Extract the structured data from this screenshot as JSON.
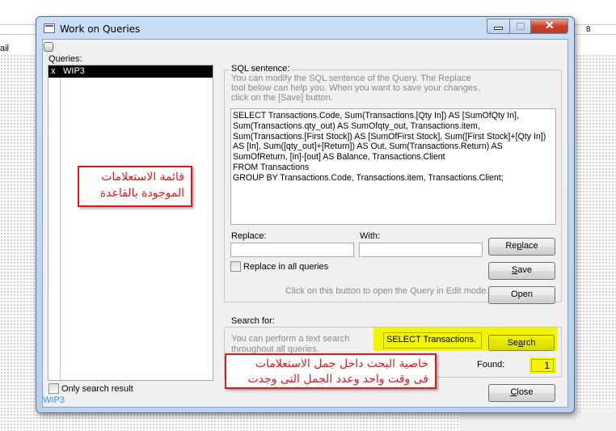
{
  "background": {
    "ruler_mark": "8",
    "section_label": "ail"
  },
  "window": {
    "title": "Work on Queries",
    "icon": "form-icon"
  },
  "queries": {
    "label": "Queries:",
    "items": [
      {
        "marker": "x",
        "name": "WIP3",
        "selected": true
      }
    ],
    "only_search_result_label": "Only search result",
    "only_search_result_checked": false,
    "current_query": "WIP3"
  },
  "sql": {
    "group_label": "SQL sentence:",
    "help_lines": [
      "You can modify the SQL sentence of the Query. The Replace",
      "tool below can help you. When you want to save your changes,",
      "click on the [Save] button."
    ],
    "text": "SELECT Transactions.Code, Sum(Transactions.[Qty In]) AS [SumOfQty In], Sum(Transactions.qty_out) AS SumOfqty_out, Transactions.item, Sum(Transactions.[First Stock]) AS [SumOfFirst Stock], Sum([First Stock]+[Qty In]) AS [In], Sum([qty_out]+[Return]) AS Out, Sum(Transactions.Return) AS SumOfReturn, [in]-[out] AS Balance, Transactions.Client\nFROM Transactions\nGROUP BY Transactions.Code, Transactions.item, Transactions.Client;",
    "replace_label": "Replace:",
    "replace_value": "",
    "with_label": "With:",
    "with_value": "",
    "replace_all_label": "Replace in all queries",
    "replace_all_checked": false,
    "replace_button_pre": "Re",
    "replace_button_key": "p",
    "replace_button_post": "lace",
    "save_button_key": "S",
    "save_button_post": "ave",
    "open_help": "Click on this button to open the Query in Edit mode.",
    "open_button": "Open"
  },
  "search": {
    "group_label": "Search for:",
    "help_lines": [
      "You can perform a text search",
      "throughout all queries."
    ],
    "value": "SELECT Transactions.",
    "button_pre": "Se",
    "button_key": "a",
    "button_post": "rch",
    "found_label": "Found:",
    "found_value": "1",
    "highlight_color": "#f4f400"
  },
  "close_button_key": "C",
  "close_button_post": "lose",
  "annotations": {
    "queries_note": [
      "قائمة الاستعلامات",
      "الموجودة بالقاعدة"
    ],
    "search_note": [
      "خاصية البحث داخل جمل الاستعلامات",
      "فى وقت واحد وعدد الجمل التى وجدت"
    ],
    "color": "#e8141c"
  }
}
